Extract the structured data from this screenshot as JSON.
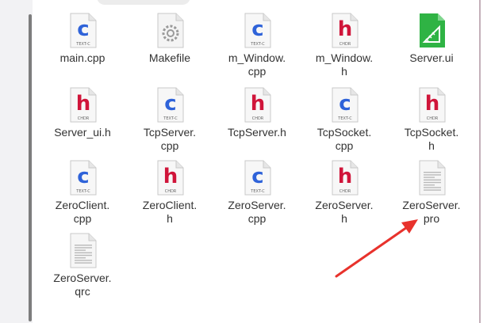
{
  "window": {
    "accent_arrow_color": "#e8322c"
  },
  "files": [
    {
      "name": "main.cpp",
      "type": "c"
    },
    {
      "name": "Makefile",
      "type": "make"
    },
    {
      "name": "m_Window.\ncpp",
      "type": "c"
    },
    {
      "name": "m_Window.\nh",
      "type": "h"
    },
    {
      "name": "Server.ui",
      "type": "ui"
    },
    {
      "name": "Server_ui.h",
      "type": "h"
    },
    {
      "name": "TcpServer.\ncpp",
      "type": "c"
    },
    {
      "name": "TcpServer.h",
      "type": "h"
    },
    {
      "name": "TcpSocket.\ncpp",
      "type": "c"
    },
    {
      "name": "TcpSocket.\nh",
      "type": "h"
    },
    {
      "name": "ZeroClient.\ncpp",
      "type": "c"
    },
    {
      "name": "ZeroClient.\nh",
      "type": "h"
    },
    {
      "name": "ZeroServer.\ncpp",
      "type": "c"
    },
    {
      "name": "ZeroServer.\nh",
      "type": "h"
    },
    {
      "name": "ZeroServer.\npro",
      "type": "text"
    },
    {
      "name": "ZeroServer.\nqrc",
      "type": "text"
    }
  ],
  "icons": {
    "c": {
      "letter": "c",
      "sub": "TEXT-C",
      "color": "#2f63d9"
    },
    "h": {
      "letter": "h",
      "sub": "CHDR",
      "color": "#d0153a"
    },
    "make": {
      "name": "gear-icon"
    },
    "ui": {
      "name": "ui-designer-icon",
      "color": "#2fb344"
    },
    "text": {
      "name": "text-document-icon"
    }
  }
}
